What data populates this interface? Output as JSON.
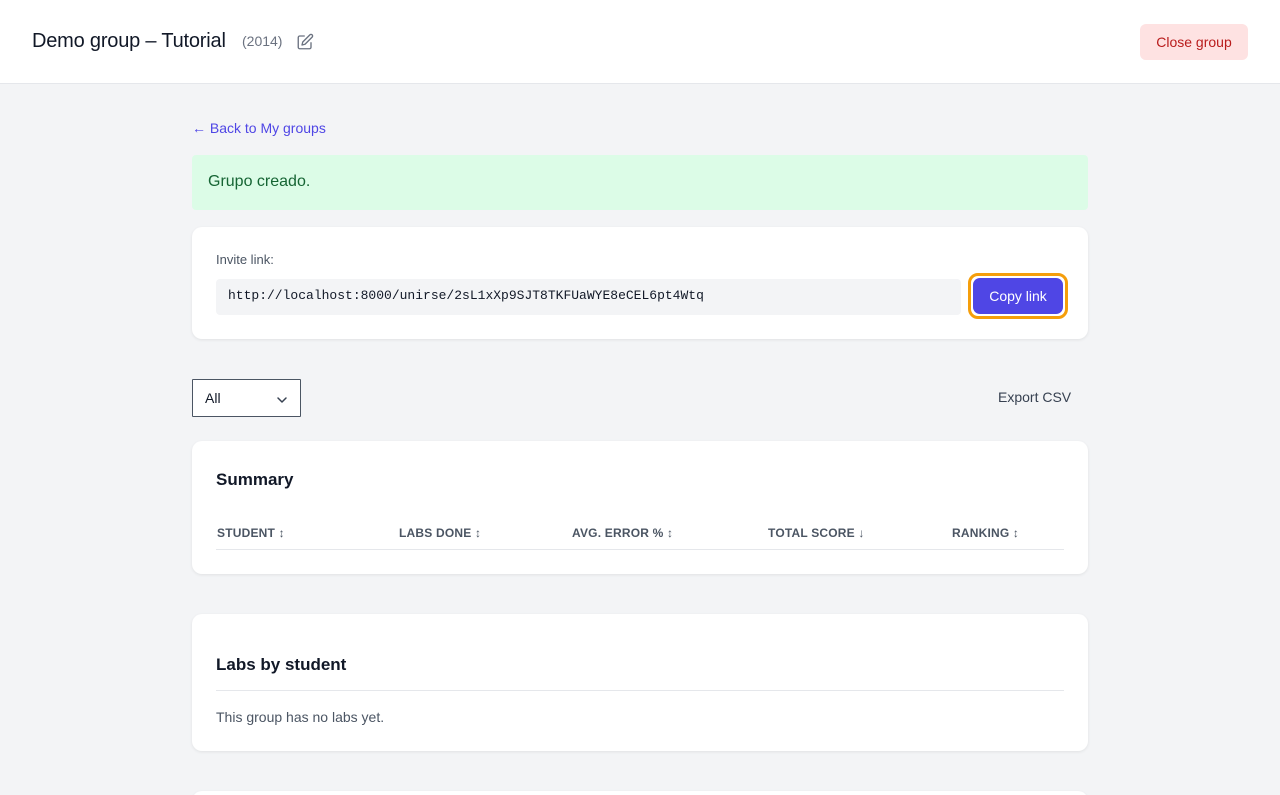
{
  "header": {
    "title": "Demo group – Tutorial",
    "year": "(2014)",
    "edit_icon": "edit-icon",
    "close_button": "Close group"
  },
  "back_link": "← Back to My groups",
  "alert": {
    "message": "Grupo creado."
  },
  "invite": {
    "label": "Invite link:",
    "url": "http://localhost:8000/unirse/2sL1xXp9SJT8TKFUaWYE8eCEL6pt4Wtq",
    "copy_button": "Copy link"
  },
  "filter": {
    "selected": "All"
  },
  "export_label": "Export CSV",
  "summary": {
    "title": "Summary",
    "columns": [
      "STUDENT ↕",
      "LABS DONE ↕",
      "AVG. ERROR % ↕",
      "TOTAL SCORE ↓",
      "RANKING ↕"
    ]
  },
  "labs": {
    "title": "Labs by student",
    "empty_message": "This group has no labs yet."
  },
  "colors": {
    "accent": "#4f46e5",
    "success_bg": "#dcfce7",
    "danger_bg": "#fee2e2",
    "focus_ring": "#f59e0b"
  }
}
